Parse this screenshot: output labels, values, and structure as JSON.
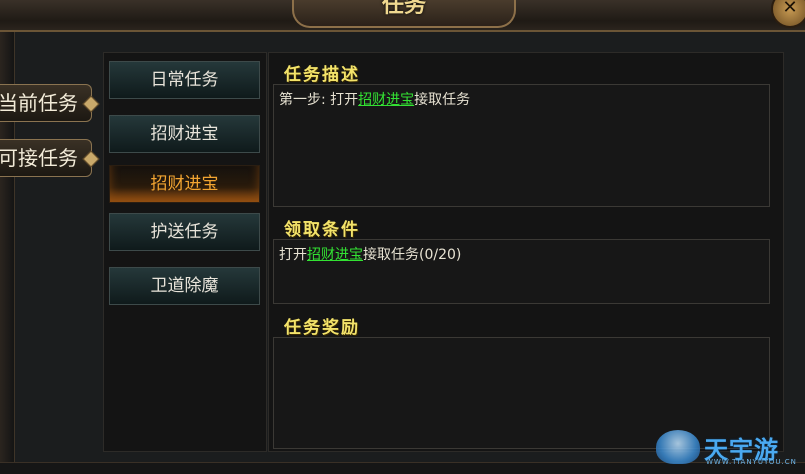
{
  "window": {
    "title": "任务",
    "close_label": "✕"
  },
  "left_tabs": [
    {
      "label": "当前任务"
    },
    {
      "label": "可接任务"
    }
  ],
  "categories": [
    {
      "label": "日常任务",
      "active": false
    },
    {
      "label": "招财进宝",
      "active": false
    },
    {
      "label": "招财进宝",
      "active": true
    },
    {
      "label": "护送任务",
      "active": false
    },
    {
      "label": "卫道除魔",
      "active": false
    }
  ],
  "sections": {
    "description": {
      "title": "任务描述",
      "prefix": "第一步: 打开",
      "link": "招财进宝",
      "suffix": "接取任务"
    },
    "requirements": {
      "title": "领取条件",
      "prefix": "打开",
      "link": "招财进宝",
      "suffix": "接取任务(0/20)"
    },
    "rewards": {
      "title": "任务奖励"
    }
  },
  "watermark": {
    "text": "天宇游",
    "sub": "WWW.TIANYUYOU.CN"
  },
  "colors": {
    "highlight_link": "#33e233",
    "section_title": "#f3e36a",
    "active_category": "#f3a531"
  }
}
